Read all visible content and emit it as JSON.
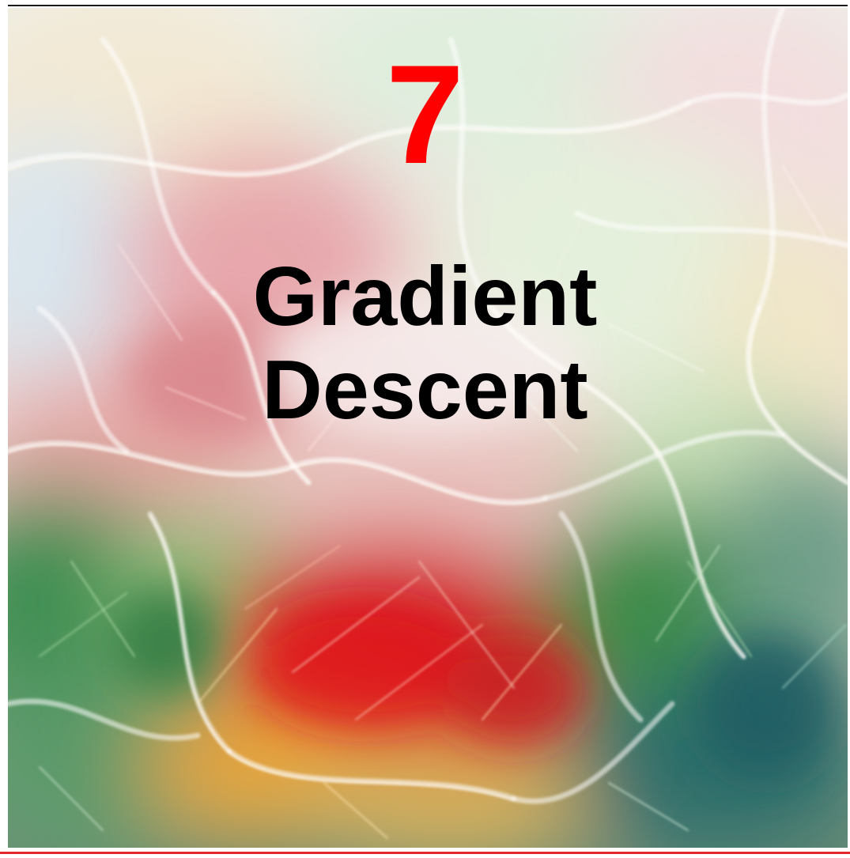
{
  "chapter": {
    "number": "7",
    "title_line_1": "Gradient",
    "title_line_2": "Descent"
  },
  "colors": {
    "chapter_number": "#ff0000",
    "title": "#000000",
    "bottom_rule": "#e3262b",
    "top_rule": "#1a1a1a"
  }
}
